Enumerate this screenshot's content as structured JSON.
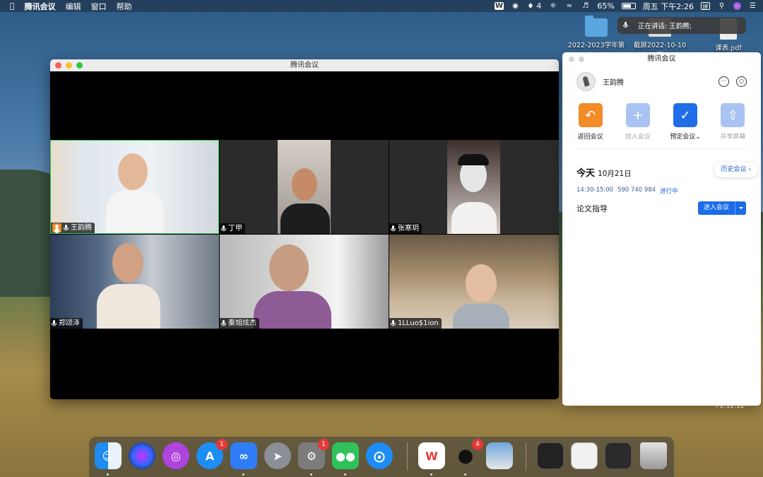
{
  "menubar": {
    "app_name": "腾讯会议",
    "menus": [
      "编辑",
      "窗口",
      "帮助"
    ],
    "notification_count": "4",
    "battery": "65%",
    "datetime": "周五 下午2:26"
  },
  "desktop": {
    "files": [
      {
        "label": "2022-2023学年第",
        "icon": "folder-icon"
      },
      {
        "label": "截屏2022-10-10 下",
        "icon": "screenshot-icon"
      },
      {
        "label": "课表.pdf",
        "icon": "pdf-icon"
      }
    ],
    "speaking_notice": "正在讲话: 王韵腾;"
  },
  "meeting_window": {
    "title": "腾讯会议",
    "participants": [
      {
        "name": "王韵腾",
        "host": true,
        "active_speaker": true,
        "muted": false
      },
      {
        "name": "丁甲",
        "host": false,
        "active_speaker": false,
        "muted": false
      },
      {
        "name": "张寒玥",
        "host": false,
        "active_speaker": false,
        "muted": true
      },
      {
        "name": "郑颂泽",
        "host": false,
        "active_speaker": false,
        "muted": true
      },
      {
        "name": "秦旭炫杰",
        "host": false,
        "active_speaker": false,
        "muted": true
      },
      {
        "name": "1LLuo$1ion",
        "host": false,
        "active_speaker": false,
        "muted": true
      }
    ]
  },
  "side_panel": {
    "title": "腾讯会议",
    "user_name": "王韵腾",
    "actions": [
      {
        "label": "返回会议",
        "icon": "return-icon",
        "color": "#f28b28",
        "enabled": true
      },
      {
        "label": "加入会议",
        "icon": "plus-icon",
        "color": "#a9c4f2",
        "enabled": false
      },
      {
        "label": "预定会议",
        "icon": "calendar-icon",
        "color": "#1f6ee8",
        "enabled": true,
        "has_dropdown": true
      },
      {
        "label": "共享屏幕",
        "icon": "share-screen-icon",
        "color": "#a9c4f2",
        "enabled": false
      }
    ],
    "today_label": "今天",
    "date": "10月21日",
    "history_label": "历史会议",
    "meeting": {
      "time": "14:30-15:00",
      "id": "590 740 984",
      "status": "进行中",
      "title": "论文指导",
      "join_label": "进入会议"
    }
  },
  "background_clock": "下2:12:12",
  "dock": {
    "apps": [
      {
        "name": "Finder",
        "icon": "finder-icon"
      },
      {
        "name": "Siri",
        "icon": "siri-icon"
      },
      {
        "name": "Podcasts",
        "icon": "podcasts-icon"
      },
      {
        "name": "App Store",
        "icon": "app-store-icon",
        "badge": "1"
      },
      {
        "name": "腾讯会议",
        "icon": "tencent-meeting-icon"
      },
      {
        "name": "Launchpad",
        "icon": "launchpad-icon"
      },
      {
        "name": "System Preferences",
        "icon": "system-preferences-icon",
        "badge": "1"
      },
      {
        "name": "WeChat",
        "icon": "wechat-icon"
      },
      {
        "name": "Safari",
        "icon": "safari-icon"
      },
      {
        "name": "WPS",
        "icon": "wps-icon"
      },
      {
        "name": "QQ",
        "icon": "qq-icon",
        "badge": "4"
      },
      {
        "name": "Preview",
        "icon": "preview-icon"
      },
      {
        "name": "Recent 1",
        "icon": "recent-window-icon"
      },
      {
        "name": "Recent 2",
        "icon": "recent-window-icon"
      },
      {
        "name": "Recent 3",
        "icon": "recent-window-icon"
      },
      {
        "name": "Trash",
        "icon": "trash-icon"
      }
    ]
  }
}
